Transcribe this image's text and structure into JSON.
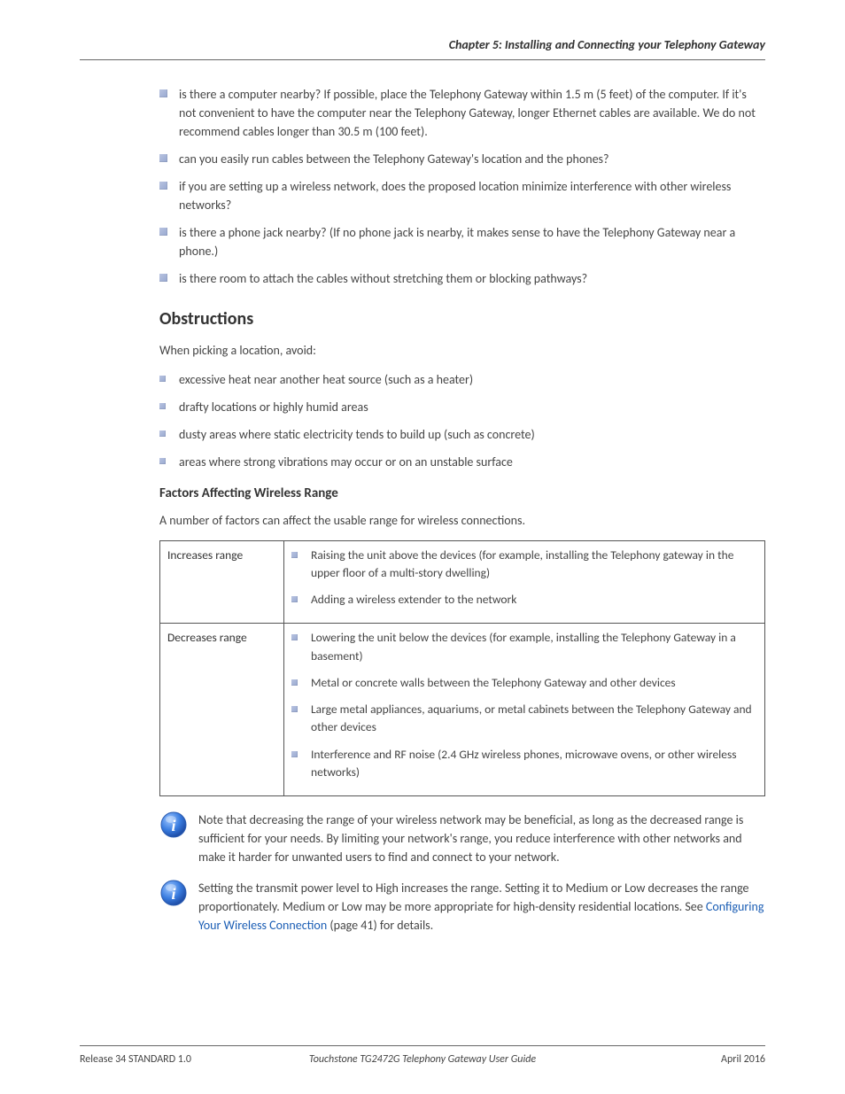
{
  "header": {
    "chapter": "Chapter 5: Installing and Connecting your Telephony Gateway"
  },
  "top_list": [
    "is there a computer nearby? If possible, place the Telephony Gateway within 1.5 m (5 feet) of the computer. If it's not convenient to have the computer near the Telephony Gateway, longer Ethernet cables are available. We do not recommend cables longer than 30.5 m (100 feet).",
    "can you easily run cables between the Telephony Gateway's location and the phones?",
    "if you are setting up a wireless network, does the proposed location minimize interference with other wireless networks?",
    "is there a phone jack nearby? (If no phone jack is nearby, it makes sense to have the Telephony Gateway near a phone.)",
    "is there room to attach the cables without stretching them or blocking pathways?"
  ],
  "factors": {
    "heading": "Factors Affecting Wireless Range",
    "intro": "A number of factors can affect the usable range for wireless connections.",
    "increases": {
      "label": "Increases range",
      "items": [
        "Raising the unit above the devices (for example, installing the Telephony gateway in the upper floor of a multi-story dwelling)",
        "Adding a wireless extender to the network"
      ]
    },
    "decreases": {
      "label": "Decreases range",
      "items": [
        "Lowering the unit below the devices (for example, installing the Telephony Gateway in a basement)",
        "Metal or concrete walls between the Telephony Gateway and other devices",
        "Large metal appliances, aquariums, or metal cabinets between the Telephony Gateway and other devices",
        "Interference and RF noise (2.4 GHz wireless phones, microwave ovens, or other wireless networks)"
      ]
    }
  },
  "obstructions": {
    "heading": "Obstructions",
    "intro": "When picking a location, avoid:",
    "items": [
      "excessive heat near another heat source (such as a heater)",
      "drafty locations or highly humid areas",
      "dusty areas where static electricity tends to build up (such as concrete)",
      "areas where strong vibrations may occur or on an unstable surface"
    ]
  },
  "notes": {
    "note1": "Note that decreasing the range of your wireless network may be beneficial, as long as the decreased range is sufficient for your needs. By limiting your network's range, you reduce interference with other networks and make it harder for unwanted users to find and connect to your network.",
    "note2_prefix": "Setting the transmit power level to High increases the range. Setting it to Medium or Low decreases the range proportionately. Medium or Low may be more appropriate for high-density residential locations. See ",
    "note2_link": "Configuring Your Wireless Connection",
    "note2_suffix": " (page 41) for details."
  },
  "footer": {
    "left": "Release 34 STANDARD 1.0",
    "mid": "Touchstone TG2472G Telephony Gateway User Guide",
    "right": "April 2016"
  }
}
